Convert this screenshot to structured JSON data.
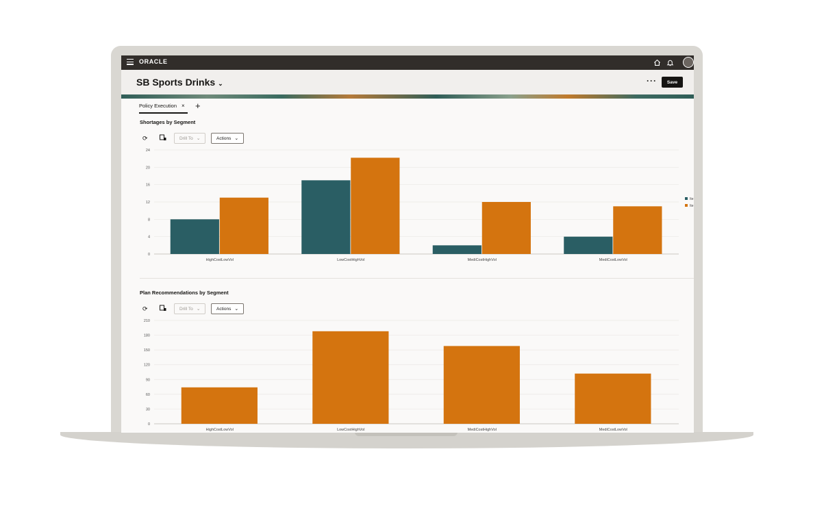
{
  "app": {
    "logo": "ORACLE"
  },
  "header": {
    "title": "SB Sports Drinks",
    "more_label": "···",
    "save_label": "Save"
  },
  "tabs": [
    {
      "label": "Policy Execution",
      "close": "×"
    }
  ],
  "tab_add": "+",
  "toolbar": {
    "drill_label": "Drill To",
    "actions_label": "Actions"
  },
  "icons": [
    "menu-icon",
    "home-icon",
    "bell-icon",
    "user-avatar",
    "refresh-icon",
    "view-icon",
    "chevron-down-icon",
    "close-icon",
    "plus-icon"
  ],
  "colors": {
    "topbar": "#312d2a",
    "series1": "#2a5e64",
    "series2": "#d4740f"
  },
  "chart_data": [
    {
      "type": "bar",
      "title": "Shortages by Segment",
      "categories": [
        "HighCostLowVol",
        "LowCostHighVol",
        "MediCostHighVol",
        "MediCostLowVol"
      ],
      "series": [
        {
          "name": "Ite",
          "color": "#2a5e64",
          "values": [
            8,
            17,
            2,
            4
          ]
        },
        {
          "name": "Ite",
          "color": "#d4740f",
          "values": [
            13,
            22.2,
            12,
            11
          ]
        }
      ],
      "yticks": [
        "0",
        "4",
        "8",
        "12",
        "16",
        "20",
        "24"
      ],
      "ylim": [
        0,
        24
      ],
      "grid": true,
      "legend": "right"
    },
    {
      "type": "bar",
      "title": "Plan Recommendations by Segment",
      "categories": [
        "HighCostLowVol",
        "LowCostHighVol",
        "MediCostHighVol",
        "MediCostLowVol"
      ],
      "series": [
        {
          "color": "#d4740f",
          "values": [
            74,
            188,
            158,
            102
          ]
        }
      ],
      "yticks": [
        "0",
        "30",
        "60",
        "90",
        "120",
        "150",
        "180",
        "210"
      ],
      "ylim": [
        0,
        210
      ],
      "grid": true
    }
  ]
}
